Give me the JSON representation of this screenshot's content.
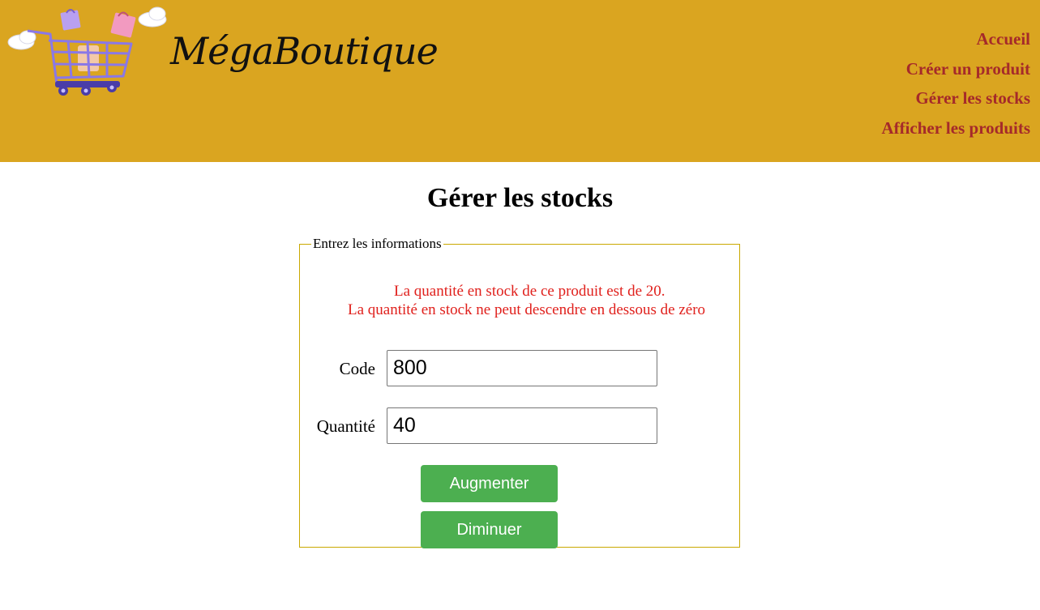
{
  "header": {
    "brand": "MégaBoutique",
    "logo_icon": "shopping-cart-icon",
    "background": "#daa520",
    "nav_color": "#a52a2a",
    "nav": [
      {
        "label": "Accueil"
      },
      {
        "label": "Créer un produit"
      },
      {
        "label": "Gérer les stocks"
      },
      {
        "label": "Afficher les produits"
      }
    ]
  },
  "main": {
    "title": "Gérer les stocks",
    "form": {
      "legend": "Entrez les informations",
      "message_color": "#e0201c",
      "messages": [
        "La quantité en stock de ce produit est de 20.",
        "La quantité en stock ne peut descendre en dessous de zéro"
      ],
      "code_label": "Code",
      "code_value": "800",
      "quantity_label": "Quantité",
      "quantity_value": "40",
      "increase_label": "Augmenter",
      "decrease_label": "Diminuer",
      "button_color": "#4caf50"
    }
  }
}
